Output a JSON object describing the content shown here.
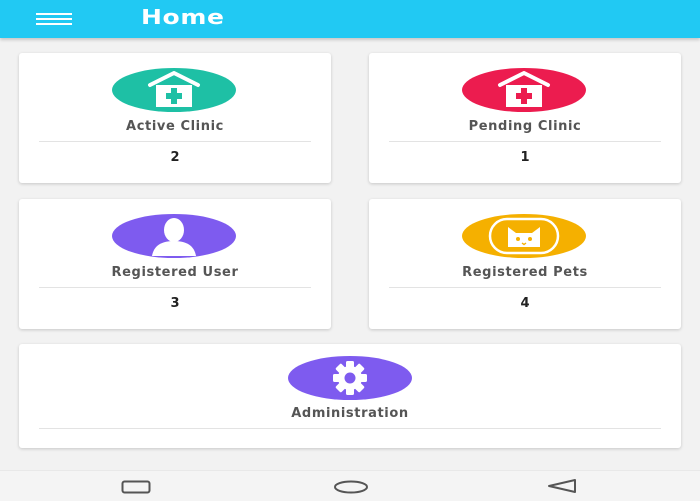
{
  "header": {
    "title": "Home",
    "background": "#21c9f3",
    "menu_icon": "hamburger-menu-icon"
  },
  "cards": [
    {
      "id": "active-clinic",
      "label": "Active Clinic",
      "value": "2",
      "icon": "clinic-icon",
      "color": "#1ec0a5"
    },
    {
      "id": "pending-clinic",
      "label": "Pending Clinic",
      "value": "1",
      "icon": "clinic-icon",
      "color": "#ec1c4f"
    },
    {
      "id": "registered-user",
      "label": "Registered User",
      "value": "3",
      "icon": "user-icon",
      "color": "#7e5bef"
    },
    {
      "id": "registered-pets",
      "label": "Registered Pets",
      "value": "4",
      "icon": "cat-icon",
      "color": "#f5b000"
    },
    {
      "id": "administration",
      "label": "Administration",
      "icon": "gear-icon",
      "color": "#7e5bef"
    }
  ],
  "nav": {
    "recents_icon": "square-icon",
    "home_icon": "circle-icon",
    "back_icon": "triangle-back-icon"
  }
}
